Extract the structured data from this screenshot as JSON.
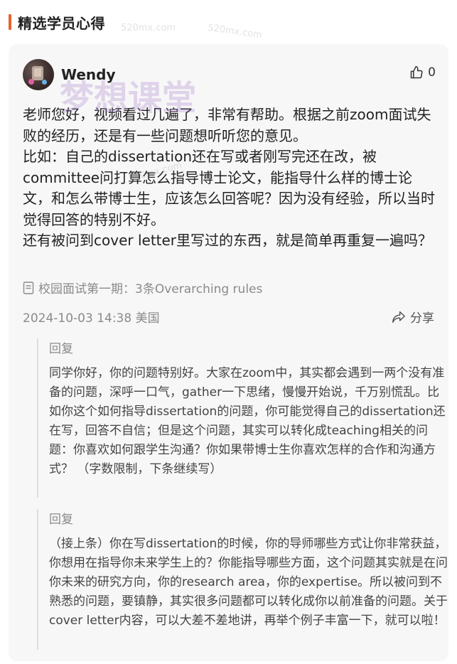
{
  "section": {
    "title": "精选学员心得"
  },
  "post": {
    "author": "Wendy",
    "likes": "0",
    "content": "老师您好，视频看过几遍了，非常有帮助。根据之前zoom面试失败的经历，还是有一些问题想听听您的意见。\n比如：自己的dissertation还在写或者刚写完还在改，被committee问打算怎么指导博士论文，能指导什么样的博士论文，和怎么带博士生，应该怎么回答呢？因为没有经验，所以当时觉得回答的特别不好。\n还有被问到cover letter里写过的东西，就是简单再重复一遍吗？",
    "source": "校园面试第一期：3条Overarching rules",
    "timestamp": "2024-10-03 14:38",
    "location": "美国",
    "share_label": "分享"
  },
  "replies": [
    {
      "label": "回复",
      "text": "同学你好，你的问题特别好。大家在zoom中，其实都会遇到一两个没有准备的问题，深呼一口气，gather一下思绪，慢慢开始说，千万别慌乱。比如你这个如何指导dissertation的问题，你可能觉得自己的dissertation还在写，回答不自信；但是这个问题，其实可以转化成teaching相关的问题：你喜欢如何跟学生沟通？你如果带博士生你喜欢怎样的合作和沟通方式？ （字数限制，下条继续写）"
    },
    {
      "label": "回复",
      "text": "（接上条）你在写dissertation的时候，你的导师哪些方式让你非常获益，你想用在指导你未来学生上的？你能指导哪些方面，这个问题其实就是在问你未来的研究方向，你的research area，你的expertise。所以被问到不熟悉的问题，要镇静，其实很多问题都可以转化成你以前准备的问题。关于cover letter内容，可以大差不差地讲，再举个例子丰富一下，就可以啦！"
    }
  ],
  "watermarks": {
    "main": "梦想课堂",
    "url_1": "520mx.com",
    "url_2": "520mx.com",
    "url_3": "520mx.com"
  },
  "colors": {
    "accent": "#e8632e",
    "card_bg": "#f7f7f7",
    "muted": "#8a8a8a"
  },
  "icons": {
    "like": "thumbs-up-icon",
    "source": "document-icon",
    "share": "share-icon"
  }
}
